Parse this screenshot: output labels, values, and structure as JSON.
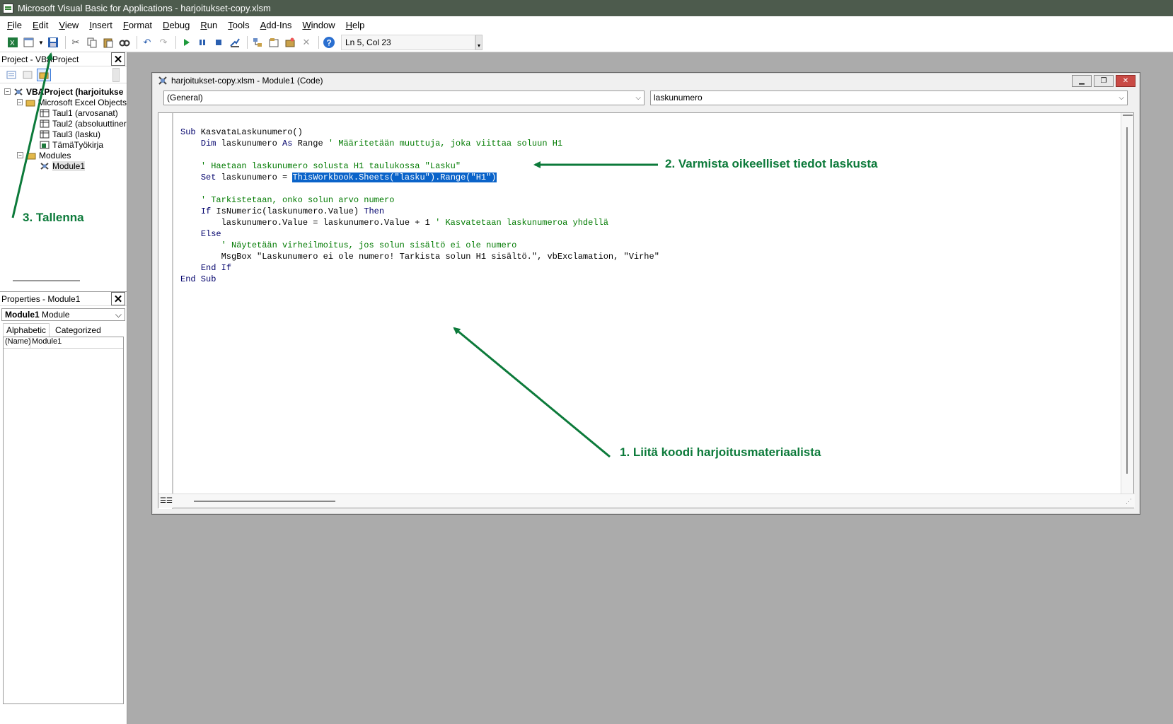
{
  "window": {
    "title": "Microsoft Visual Basic for Applications - harjoitukset-copy.xlsm"
  },
  "menu": [
    "File",
    "Edit",
    "View",
    "Insert",
    "Format",
    "Debug",
    "Run",
    "Tools",
    "Add-Ins",
    "Window",
    "Help"
  ],
  "toolbar": {
    "position": "Ln 5, Col 23"
  },
  "project_panel": {
    "title": "Project - VBAProject",
    "tree": [
      {
        "label": "VBAProject (harjoitukse",
        "level": 0,
        "icon": "vbaproject-icon",
        "bold": true
      },
      {
        "label": "Microsoft Excel Objects",
        "level": 1,
        "icon": "folder-icon"
      },
      {
        "label": "Taul1 (arvosanat)",
        "level": 2,
        "icon": "sheet-icon"
      },
      {
        "label": "Taul2 (absoluuttiner",
        "level": 2,
        "icon": "sheet-icon"
      },
      {
        "label": "Taul3 (lasku)",
        "level": 2,
        "icon": "sheet-icon"
      },
      {
        "label": "TämäTyökirja",
        "level": 2,
        "icon": "workbook-icon"
      },
      {
        "label": "Modules",
        "level": 1,
        "icon": "folder-icon"
      },
      {
        "label": "Module1",
        "level": 2,
        "icon": "module-icon",
        "selected": true
      }
    ]
  },
  "properties_panel": {
    "title": "Properties - Module1",
    "object_name": "Module1",
    "object_type": "Module",
    "tabs": [
      "Alphabetic",
      "Categorized"
    ],
    "rows": [
      {
        "key": "(Name)",
        "value": "Module1"
      }
    ]
  },
  "code_window": {
    "title": "harjoitukset-copy.xlsm - Module1 (Code)",
    "object_combo": "(General)",
    "procedure_combo": "laskunumero",
    "code_lines": [
      "Sub KasvataLaskunumero()",
      "    Dim laskunumero As Range ' Määritetään muuttuja, joka viittaa soluun H1",
      "",
      "    ' Haetaan laskunumero solusta H1 taulukossa \"Lasku\"",
      "    Set laskunumero = ThisWorkbook.Sheets(\"lasku\").Range(\"H1\")",
      "",
      "    ' Tarkistetaan, onko solun arvo numero",
      "    If IsNumeric(laskunumero.Value) Then",
      "        laskunumero.Value = laskunumero.Value + 1 ' Kasvatetaan laskunumeroa yhdellä",
      "    Else",
      "        ' Näytetään virheilmoitus, jos solun sisältö ei ole numero",
      "        MsgBox \"Laskunumero ei ole numero! Tarkista solun H1 sisältö.\", vbExclamation, \"Virhe\"",
      "    End If",
      "End Sub"
    ]
  },
  "annotations": {
    "step1": "1. Liitä koodi harjoitusmateriaalista",
    "step2": "2. Varmista oikeelliset tiedot laskusta",
    "step3": "3. Tallenna",
    "color": "#0c7a3a"
  }
}
